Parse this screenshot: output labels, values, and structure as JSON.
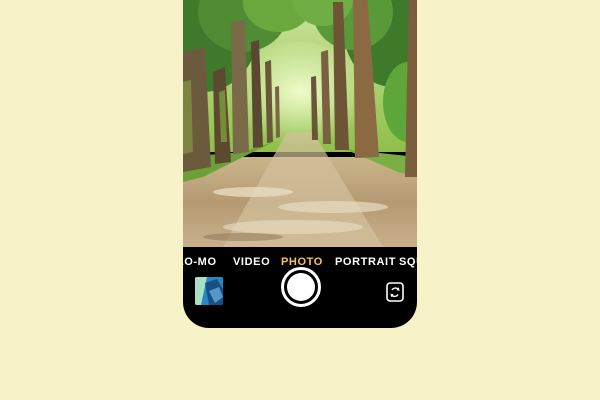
{
  "camera": {
    "modes": [
      {
        "label": "SLO-MO",
        "active": false
      },
      {
        "label": "VIDEO",
        "active": false
      },
      {
        "label": "PHOTO",
        "active": true
      },
      {
        "label": "PORTRAIT",
        "active": false
      },
      {
        "label": "SQUARE",
        "active": false
      }
    ],
    "colors": {
      "background": "#f8f2c8",
      "active_mode": "#f6c552",
      "inactive_mode": "#ffffff",
      "phone_body": "#000000"
    },
    "icons": {
      "shutter": "shutter-button",
      "switch_camera": "camera-switch-icon",
      "last_photo": "photo-thumbnail"
    }
  }
}
